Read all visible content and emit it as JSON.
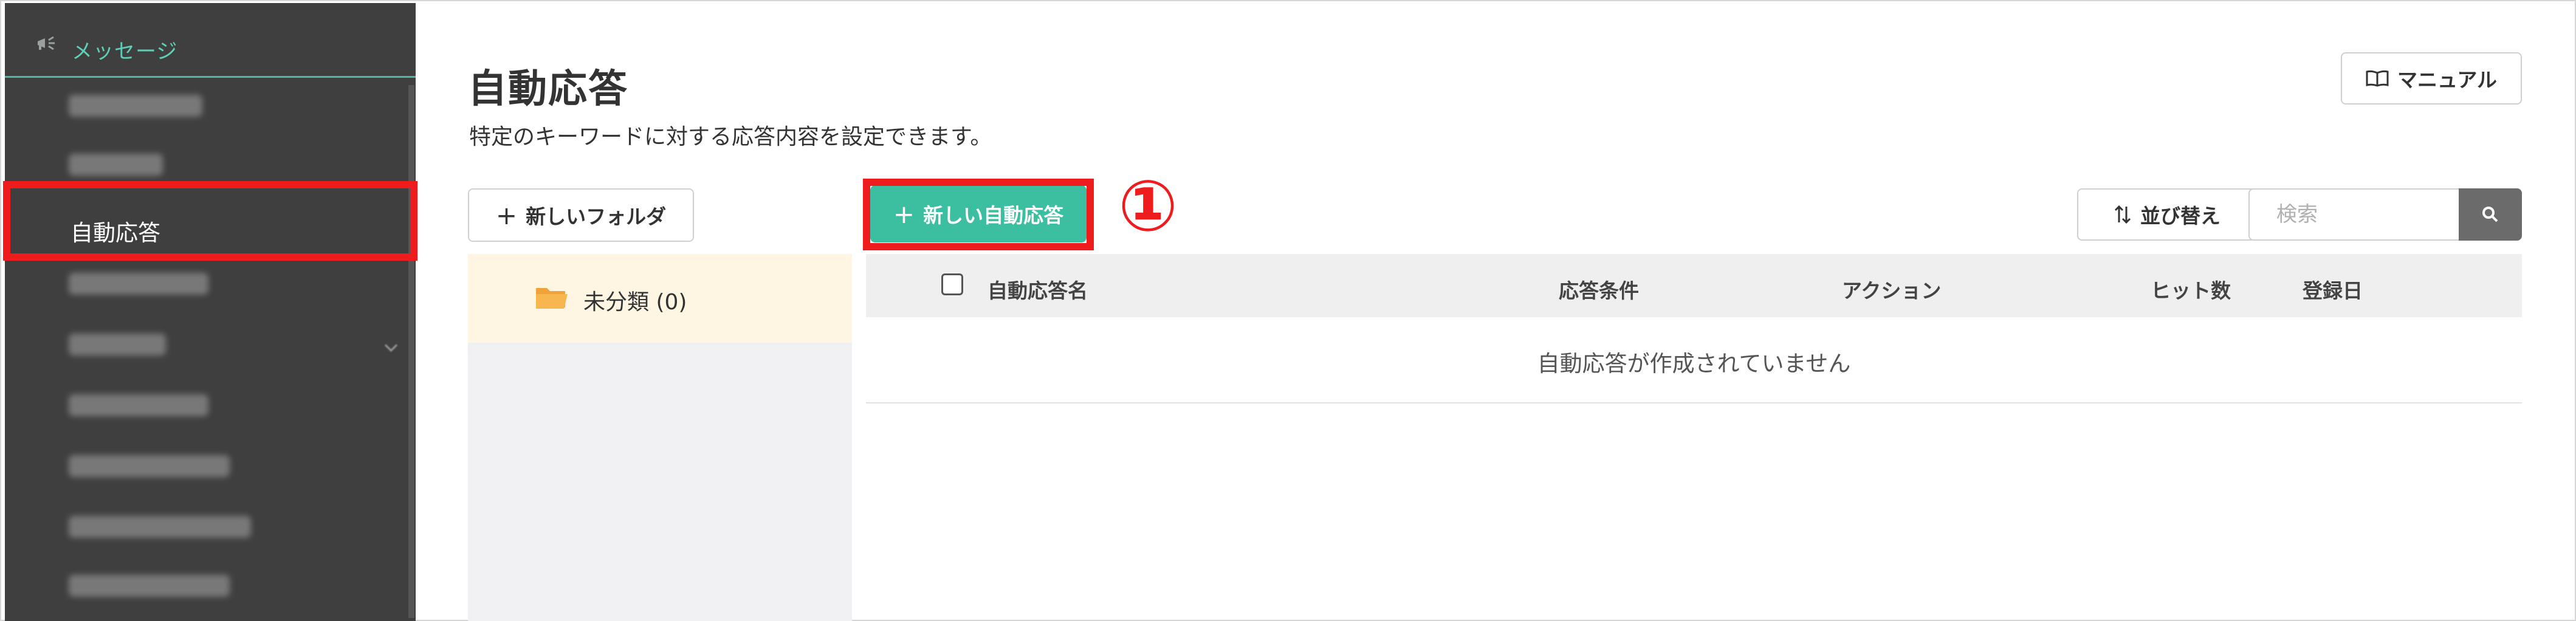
{
  "sidebar": {
    "header_label": "メッセージ",
    "active_item_label": "自動応答",
    "blurred_item_count_note": ""
  },
  "header": {
    "title": "自動応答",
    "description": "特定のキーワードに対する応答内容を設定できます。",
    "manual_button": "マニュアル"
  },
  "toolbar": {
    "new_folder_button": "新しいフォルダ",
    "new_autoreply_button": "新しい自動応答",
    "step_marker": "①",
    "sort_button": "並び替え",
    "search_placeholder": "検索"
  },
  "folders": {
    "items": [
      {
        "label": "未分類 (0)"
      }
    ]
  },
  "table": {
    "columns": [
      "自動応答名",
      "応答条件",
      "アクション",
      "ヒット数",
      "登録日"
    ],
    "empty_message": "自動応答が作成されていません"
  },
  "colors": {
    "sidebar_bg": "#3f3f3f",
    "accent": "#3cbfa0",
    "highlight_red": "#ee1c1c",
    "folder_row_bg": "#fff5e3"
  }
}
